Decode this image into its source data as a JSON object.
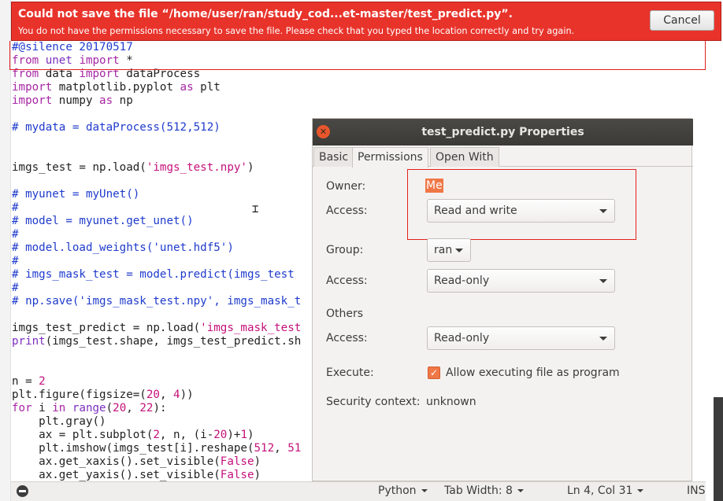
{
  "infobar": {
    "title": "Could not save the file “/home/user/ran/study_cod...et-master/test_predict.py”.",
    "message": "You do not have the permissions necessary to save the file. Please check that you typed the location correctly and try again.",
    "cancel_label": "Cancel"
  },
  "code": {
    "lines": [
      "#@silence 20170517",
      "from unet import *",
      "from data import dataProcess",
      "import matplotlib.pyplot as plt",
      "import numpy as np",
      "",
      "# mydata = dataProcess(512,512)",
      "",
      "",
      "imgs_test = np.load('imgs_test.npy')",
      "",
      "# myunet = myUnet()",
      "#",
      "# model = myunet.get_unet()",
      "#",
      "# model.load_weights('unet.hdf5')",
      "#",
      "# imgs_mask_test = model.predict(imgs_test",
      "#",
      "# np.save('imgs_mask_test.npy', imgs_mask_t",
      "",
      "imgs_test_predict = np.load('imgs_mask_test",
      "print(imgs_test.shape, imgs_test_predict.sh",
      "",
      "",
      "n = 2",
      "plt.figure(figsize=(20, 4))",
      "for i in range(20, 22):",
      "    plt.gray()",
      "    ax = plt.subplot(2, n, (i-20)+1)",
      "    plt.imshow(imgs_test[i].reshape(512, 51",
      "    ax.get_xaxis().set_visible(False)",
      "    ax.get_yaxis().set_visible(False)"
    ]
  },
  "dialog": {
    "title": "test_predict.py Properties",
    "tabs": [
      {
        "label": "Basic"
      },
      {
        "label": "Permissions"
      },
      {
        "label": "Open With"
      }
    ],
    "owner_label": "Owner:",
    "owner_value": "Me",
    "owner_access_label": "Access:",
    "owner_access_value": "Read and write",
    "group_label": "Group:",
    "group_value": "ran",
    "group_access_label": "Access:",
    "group_access_value": "Read-only",
    "others_label": "Others",
    "others_access_label": "Access:",
    "others_access_value": "Read-only",
    "execute_label": "Execute:",
    "execute_checkbox_label": "Allow executing file as program",
    "execute_checked": true,
    "security_label": "Security context:",
    "security_value": "unknown"
  },
  "statusbar": {
    "language": "Python",
    "tab_width": "Tab Width: 8",
    "position": "Ln 4, Col 31",
    "mode": "INS"
  },
  "colors": {
    "error_bar": "#e8332b",
    "accent": "#f07746",
    "annotation_box": "#e02020"
  }
}
